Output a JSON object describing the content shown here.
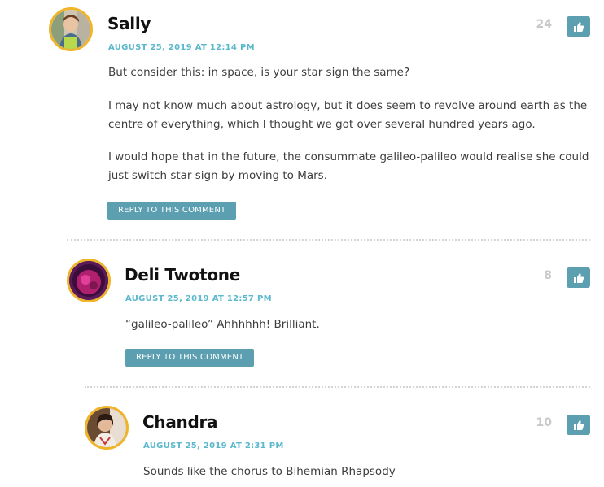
{
  "comments": [
    {
      "author": "Sally",
      "date": "AUGUST 25, 2019 AT 12:14 PM",
      "likes": "24",
      "paragraphs": [
        "But consider this: in space, is your star sign the same?",
        "I may not know much about astrology, but it does seem to revolve around earth as the centre of everything, which I thought we got over several hundred years ago.",
        "I would hope that in the future, the consummate galileo-palileo would realise she could just switch star sign by moving to Mars."
      ],
      "reply_label": "REPLY TO THIS COMMENT"
    },
    {
      "author": "Deli Twotone",
      "date": "AUGUST 25, 2019 AT 12:57 PM",
      "likes": "8",
      "paragraphs": [
        "“galileo-palileo” Ahhhhhh! Brilliant."
      ],
      "reply_label": "REPLY TO THIS COMMENT"
    },
    {
      "author": "Chandra",
      "date": "AUGUST 25, 2019 AT 2:31 PM",
      "likes": "10",
      "paragraphs": [
        "Sounds like the chorus to Bihemian Rhapsody"
      ]
    }
  ],
  "icons": {
    "avatar": "avatar-image",
    "like": "thumbs-up-icon"
  },
  "colors": {
    "author": "#111111",
    "date": "#5bb8cc",
    "button": "#5c9fb0",
    "avatar_ring": "#f0b429",
    "like_count": "#c8c8c8",
    "divider": "#d4d4d4"
  }
}
